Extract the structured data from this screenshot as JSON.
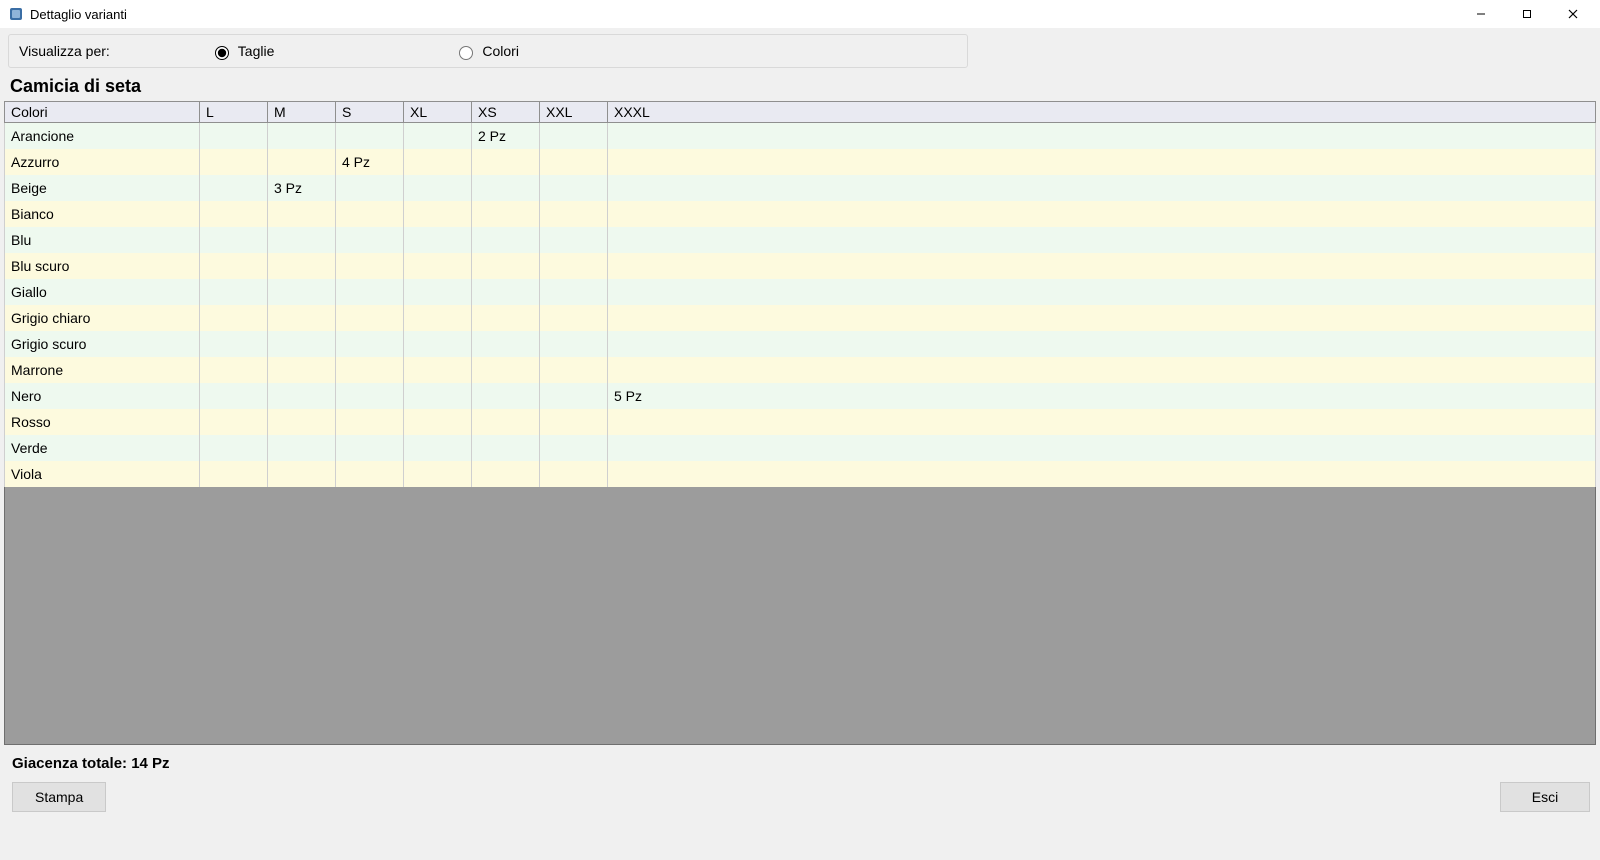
{
  "window": {
    "title": "Dettaglio varianti"
  },
  "filter": {
    "label": "Visualizza per:",
    "options": {
      "taglie": "Taglie",
      "colori": "Colori"
    },
    "selected": "taglie"
  },
  "product_title": "Camicia di seta",
  "table": {
    "headers": [
      "Colori",
      "L",
      "M",
      "S",
      "XL",
      "XS",
      "XXL",
      "XXXL"
    ],
    "rows": [
      {
        "color": "Arancione",
        "L": "",
        "M": "",
        "S": "",
        "XL": "",
        "XS": "2 Pz",
        "XXL": "",
        "XXXL": ""
      },
      {
        "color": "Azzurro",
        "L": "",
        "M": "",
        "S": "4 Pz",
        "XL": "",
        "XS": "",
        "XXL": "",
        "XXXL": ""
      },
      {
        "color": "Beige",
        "L": "",
        "M": "3 Pz",
        "S": "",
        "XL": "",
        "XS": "",
        "XXL": "",
        "XXXL": ""
      },
      {
        "color": "Bianco",
        "L": "",
        "M": "",
        "S": "",
        "XL": "",
        "XS": "",
        "XXL": "",
        "XXXL": ""
      },
      {
        "color": "Blu",
        "L": "",
        "M": "",
        "S": "",
        "XL": "",
        "XS": "",
        "XXL": "",
        "XXXL": ""
      },
      {
        "color": "Blu scuro",
        "L": "",
        "M": "",
        "S": "",
        "XL": "",
        "XS": "",
        "XXL": "",
        "XXXL": ""
      },
      {
        "color": "Giallo",
        "L": "",
        "M": "",
        "S": "",
        "XL": "",
        "XS": "",
        "XXL": "",
        "XXXL": ""
      },
      {
        "color": "Grigio chiaro",
        "L": "",
        "M": "",
        "S": "",
        "XL": "",
        "XS": "",
        "XXL": "",
        "XXXL": ""
      },
      {
        "color": "Grigio scuro",
        "L": "",
        "M": "",
        "S": "",
        "XL": "",
        "XS": "",
        "XXL": "",
        "XXXL": ""
      },
      {
        "color": "Marrone",
        "L": "",
        "M": "",
        "S": "",
        "XL": "",
        "XS": "",
        "XXL": "",
        "XXXL": ""
      },
      {
        "color": "Nero",
        "L": "",
        "M": "",
        "S": "",
        "XL": "",
        "XS": "",
        "XXL": "",
        "XXXL": "5 Pz"
      },
      {
        "color": "Rosso",
        "L": "",
        "M": "",
        "S": "",
        "XL": "",
        "XS": "",
        "XXL": "",
        "XXXL": ""
      },
      {
        "color": "Verde",
        "L": "",
        "M": "",
        "S": "",
        "XL": "",
        "XS": "",
        "XXL": "",
        "XXXL": ""
      },
      {
        "color": "Viola",
        "L": "",
        "M": "",
        "S": "",
        "XL": "",
        "XS": "",
        "XXL": "",
        "XXXL": ""
      }
    ]
  },
  "footer": {
    "total_label": "Giacenza totale: 14 Pz"
  },
  "buttons": {
    "print": "Stampa",
    "exit": "Esci"
  }
}
